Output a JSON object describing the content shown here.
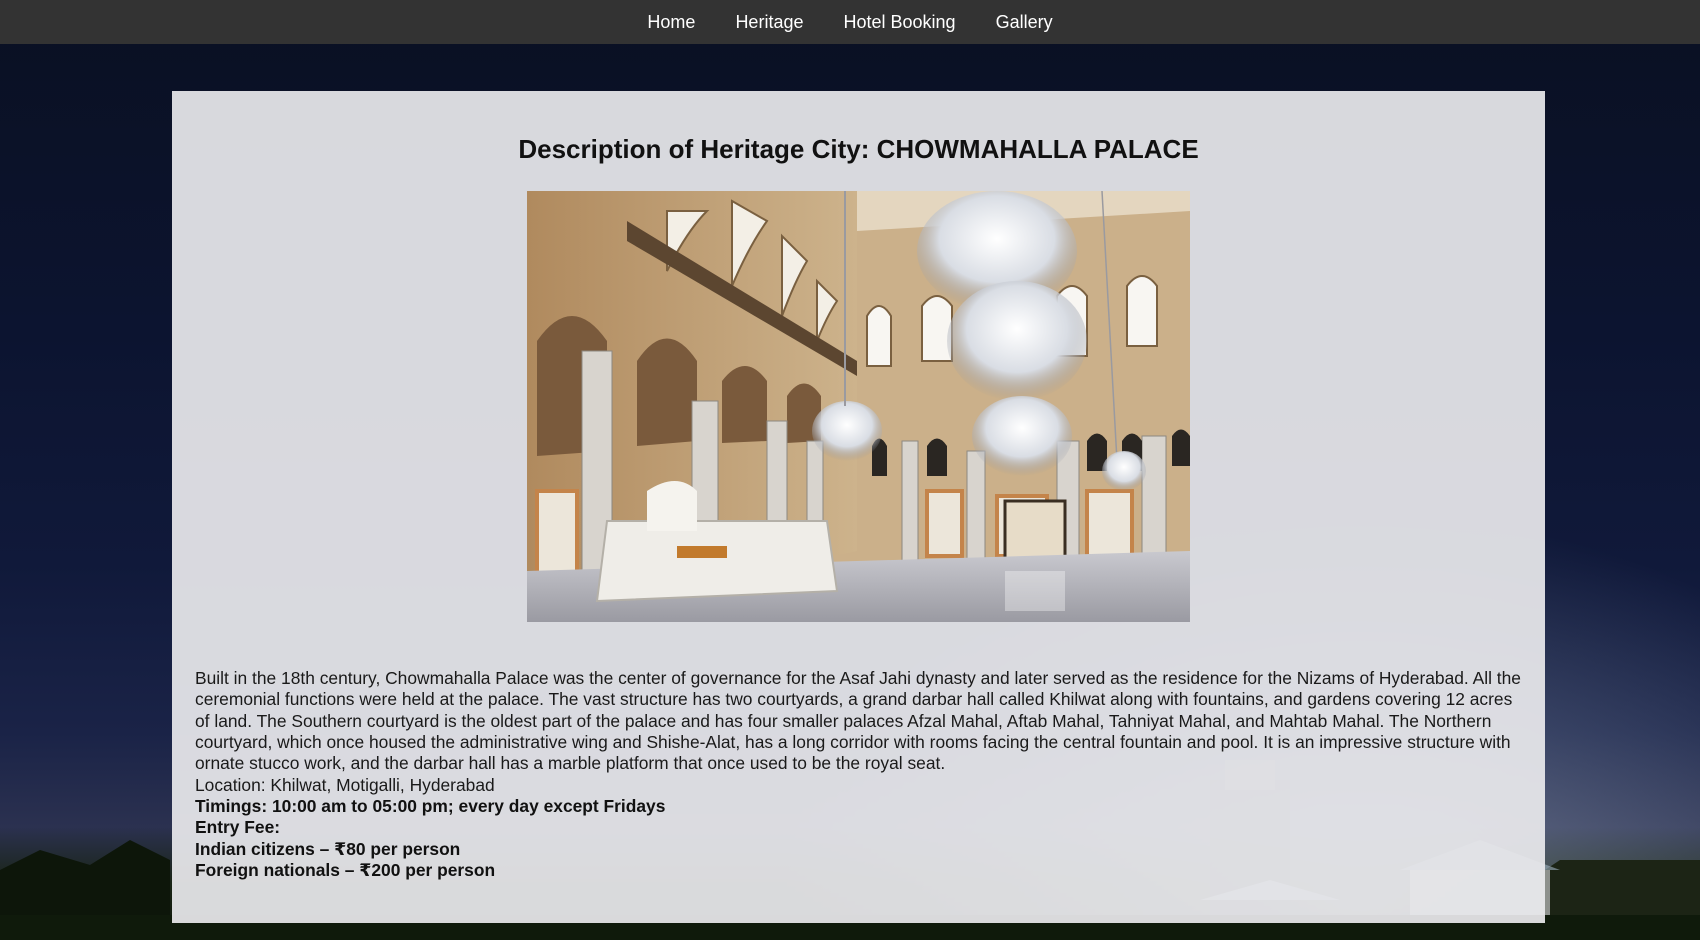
{
  "nav": {
    "items": [
      {
        "label": "Home"
      },
      {
        "label": "Heritage"
      },
      {
        "label": "Hotel Booking"
      },
      {
        "label": "Gallery"
      }
    ]
  },
  "content": {
    "title": "Description of Heritage City: CHOWMAHALLA PALACE",
    "description": "Built in the 18th century, Chowmahalla Palace was the center of governance for the Asaf Jahi dynasty and later served as the residence for the Nizams of Hyderabad. All the ceremonial functions were held at the palace. The vast structure has two courtyards, a grand darbar hall called Khilwat along with fountains, and gardens covering 12 acres of land. The Southern courtyard is the oldest part of the palace and has four smaller palaces Afzal Mahal, Aftab Mahal, Tahniyat Mahal, and Mahtab Mahal. The Northern courtyard, which once housed the administrative wing and Shishe-Alat, has a long corridor with rooms facing the central fountain and pool. It is an impressive structure with ornate stucco work, and the darbar hall has a marble platform that once used to be the royal seat.",
    "location": "Location: Khilwat, Motigalli, Hyderabad",
    "timings": "Timings: 10:00 am to 05:00 pm; every day except Fridays",
    "entry_fee_label": "Entry Fee:",
    "fee_indian": "Indian citizens – ₹80 per person",
    "fee_foreign": "Foreign nationals – ₹200 per person"
  },
  "colors": {
    "navbar": "#333333",
    "panel": "#e8e8ec"
  }
}
